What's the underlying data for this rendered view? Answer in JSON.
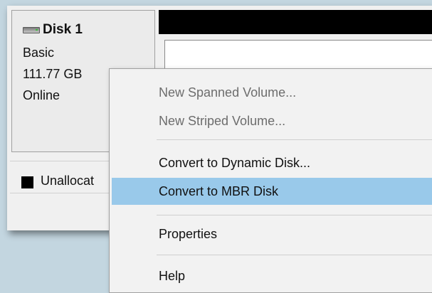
{
  "disk": {
    "name": "Disk 1",
    "type": "Basic",
    "size": "111.77 GB",
    "status": "Online"
  },
  "legend": {
    "unallocated_label": "Unallocat",
    "unallocated_color": "#000000"
  },
  "context_menu": {
    "items": [
      {
        "label": "New Spanned Volume...",
        "enabled": false
      },
      {
        "label": "New Striped Volume...",
        "enabled": false
      },
      {
        "label": "Convert to Dynamic Disk...",
        "enabled": true
      },
      {
        "label": "Convert to MBR Disk",
        "enabled": true,
        "highlighted": true
      },
      {
        "label": "Properties",
        "enabled": true
      },
      {
        "label": "Help",
        "enabled": true
      }
    ],
    "highlight_color": "#99c9ea"
  }
}
